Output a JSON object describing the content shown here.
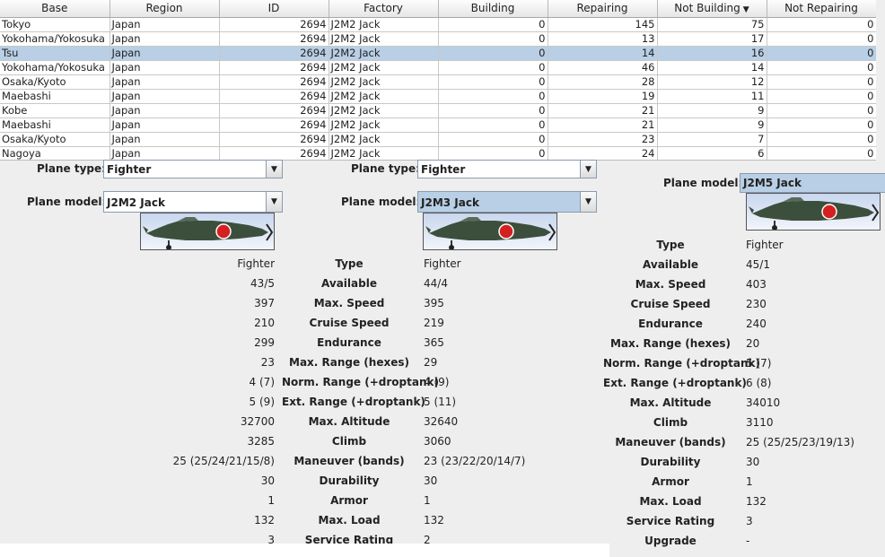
{
  "table": {
    "columns": [
      "Base",
      "Region",
      "ID",
      "Factory",
      "Building",
      "Repairing",
      "Not Building",
      "Not Repairing"
    ],
    "sort_column_index": 6,
    "selected_row": 2,
    "rows": [
      [
        "Tokyo",
        "Japan",
        "2694",
        "J2M2 Jack",
        "0",
        "145",
        "75",
        "0"
      ],
      [
        "Yokohama/Yokosuka",
        "Japan",
        "2694",
        "J2M2 Jack",
        "0",
        "13",
        "17",
        "0"
      ],
      [
        "Tsu",
        "Japan",
        "2694",
        "J2M2 Jack",
        "0",
        "14",
        "16",
        "0"
      ],
      [
        "Yokohama/Yokosuka",
        "Japan",
        "2694",
        "J2M2 Jack",
        "0",
        "46",
        "14",
        "0"
      ],
      [
        "Osaka/Kyoto",
        "Japan",
        "2694",
        "J2M2 Jack",
        "0",
        "28",
        "12",
        "0"
      ],
      [
        "Maebashi",
        "Japan",
        "2694",
        "J2M2 Jack",
        "0",
        "19",
        "11",
        "0"
      ],
      [
        "Kobe",
        "Japan",
        "2694",
        "J2M2 Jack",
        "0",
        "21",
        "9",
        "0"
      ],
      [
        "Maebashi",
        "Japan",
        "2694",
        "J2M2 Jack",
        "0",
        "21",
        "9",
        "0"
      ],
      [
        "Osaka/Kyoto",
        "Japan",
        "2694",
        "J2M2 Jack",
        "0",
        "23",
        "7",
        "0"
      ],
      [
        "Nagoya",
        "Japan",
        "2694",
        "J2M2 Jack",
        "0",
        "24",
        "6",
        "0"
      ]
    ]
  },
  "panel_left": {
    "plane_type_label": "Plane type:",
    "plane_type_value": "Fighter",
    "plane_model_label": "Plane model:",
    "plane_model_value": "J2M2 Jack",
    "values": [
      "Fighter",
      "43/5",
      "397",
      "210",
      "299",
      "23",
      "4 (7)",
      "5 (9)",
      "32700",
      "3285",
      "25 (25/24/21/15/8)",
      "30",
      "1",
      "132",
      "3"
    ]
  },
  "panel_middle": {
    "plane_type_label": "Plane type:",
    "plane_type_value": "Fighter",
    "plane_model_label": "Plane model:",
    "plane_model_value": "J2M3 Jack",
    "stat_labels": [
      "Type",
      "Available",
      "Max. Speed",
      "Cruise Speed",
      "Endurance",
      "Max. Range (hexes)",
      "Norm. Range (+droptank)",
      "Ext. Range (+droptank)",
      "Max. Altitude",
      "Climb",
      "Maneuver (bands)",
      "Durability",
      "Armor",
      "Max. Load",
      "Service Rating"
    ],
    "values": [
      "Fighter",
      "44/4",
      "395",
      "219",
      "365",
      "29",
      "4 (9)",
      "5 (11)",
      "32640",
      "3060",
      "23 (23/22/20/14/7)",
      "30",
      "1",
      "132",
      "2"
    ]
  },
  "panel_right": {
    "plane_model_label": "Plane model:",
    "plane_model_value": "J2M5 Jack",
    "stat_labels": [
      "Type",
      "Available",
      "Max. Speed",
      "Cruise Speed",
      "Endurance",
      "Max. Range (hexes)",
      "Norm. Range (+droptank)",
      "Ext. Range (+droptank)",
      "Max. Altitude",
      "Climb",
      "Maneuver (bands)",
      "Durability",
      "Armor",
      "Max. Load",
      "Service Rating",
      "Upgrade"
    ],
    "values": [
      "Fighter",
      "45/1",
      "403",
      "230",
      "240",
      "20",
      "5 (7)",
      "6 (8)",
      "34010",
      "3110",
      "25 (25/25/23/19/13)",
      "30",
      "1",
      "132",
      "3",
      "-"
    ]
  },
  "icons": {
    "dropdown": "chevron-down-icon",
    "sort": "sort-descending-icon",
    "aircraft": "aircraft-image"
  },
  "colors": {
    "selection": "#b8cfe5",
    "background": "#eeeeee",
    "roundel": "#d42020",
    "fuselage": "#3c4f3c"
  }
}
